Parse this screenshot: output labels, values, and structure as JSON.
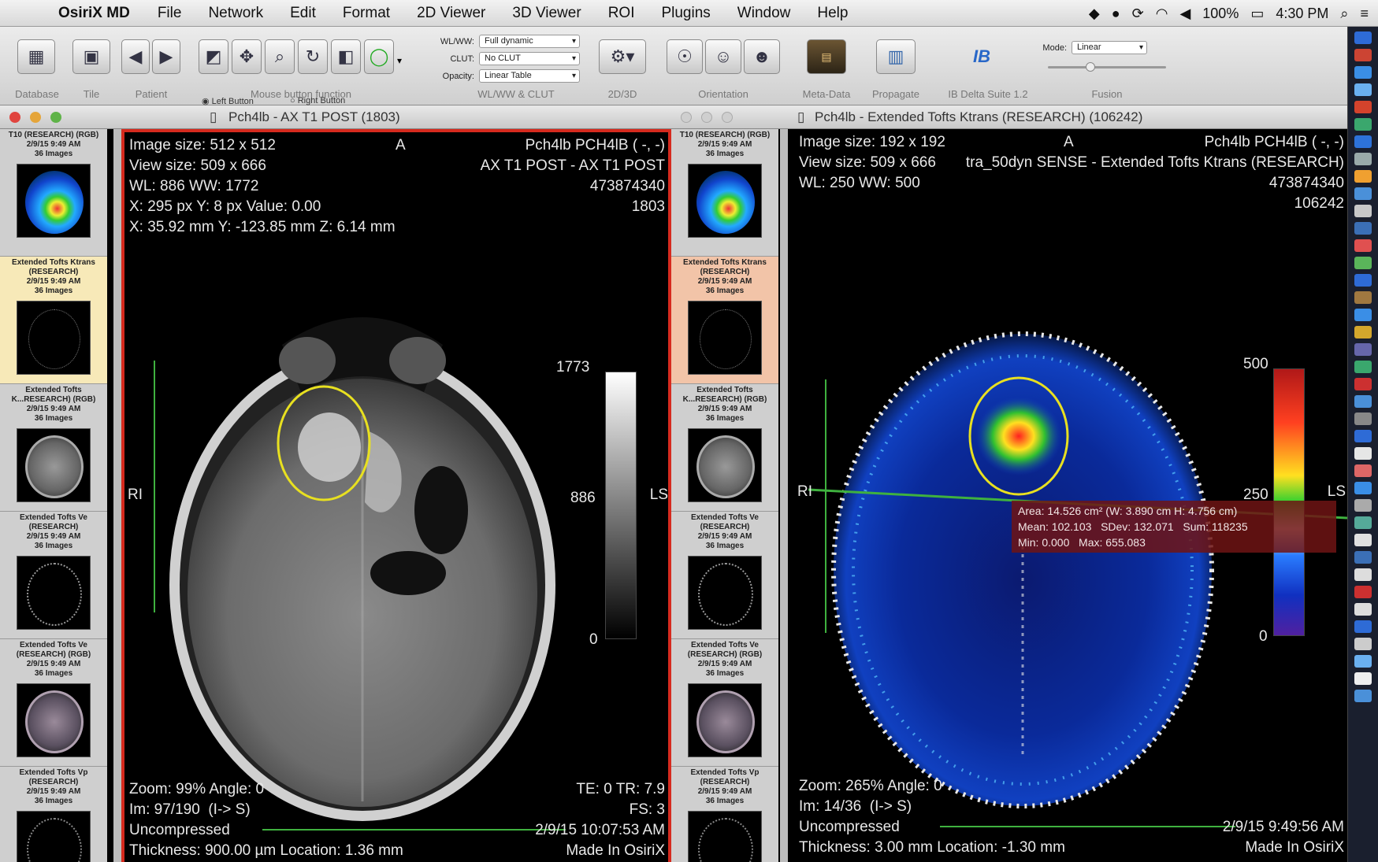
{
  "menubar": {
    "app": "OsiriX MD",
    "items": [
      "File",
      "Network",
      "Edit",
      "Format",
      "2D Viewer",
      "3D Viewer",
      "ROI",
      "Plugins",
      "Window",
      "Help"
    ],
    "battery": "100%",
    "time": "4:30 PM"
  },
  "toolbar": {
    "labels": {
      "database": "Database",
      "tile": "Tile",
      "patient": "Patient",
      "mouse": "Mouse button function",
      "wlww": "WL/WW & CLUT",
      "twoD3D": "2D/3D",
      "orientation": "Orientation",
      "metadata": "Meta-Data",
      "propagate": "Propagate",
      "delta": "IB Delta Suite 1.2",
      "fusion": "Fusion"
    },
    "left_button": "Left Button",
    "right_button": "Right Button",
    "wl_ww_label": "WL/WW:",
    "wl_ww_value": "Full dynamic",
    "clut_label": "CLUT:",
    "clut_value": "No CLUT",
    "opacity_label": "Opacity:",
    "opacity_value": "Linear Table",
    "mode_label": "Mode:",
    "mode_value": "Linear"
  },
  "left_window": {
    "title": "Pch4lb - AX T1 POST (1803)",
    "tl": [
      "Image size: 512 x 512",
      "View size: 509 x 666",
      "WL: 886 WW: 1772",
      "X: 295 px Y: 8 px Value: 0.00",
      "X: 35.92 mm Y: -123.85 mm Z: 6.14 mm"
    ],
    "top_marker": "A",
    "tr": [
      "Pch4lb PCH4lB ( -, -)",
      "AX T1 POST - AX T1 POST",
      "473874340",
      "1803"
    ],
    "left_marker": "RI",
    "right_marker": "LS",
    "scale_top": "1773",
    "scale_mid": "886",
    "scale_bottom": "0",
    "bl": [
      "Zoom: 99% Angle: 0",
      "Im: 97/190  (I-> S)",
      "Uncompressed",
      "Thickness: 900.00 µm Location: 1.36 mm"
    ],
    "br": [
      "TE: 0 TR: 7.9",
      "FS: 3",
      "2/9/15 10:07:53 AM",
      "Made In OsiriX"
    ]
  },
  "right_window": {
    "title": "Pch4lb - Extended Tofts Ktrans (RESEARCH) (106242)",
    "tl": [
      "Image size: 192 x 192",
      "View size: 509 x 666",
      "WL: 250 WW: 500"
    ],
    "top_marker": "A",
    "tr": [
      "Pch4lb PCH4lB ( -, -)",
      "tra_50dyn SENSE - Extended Tofts Ktrans (RESEARCH)",
      "473874340",
      "106242"
    ],
    "left_marker": "RI",
    "right_marker": "LS",
    "scale_top": "500",
    "scale_mid": "250",
    "scale_bottom": "0",
    "roi": [
      "Area: 14.526 cm² (W: 3.890 cm H: 4.756 cm)",
      "Mean: 102.103   SDev: 132.071   Sum: 118235",
      "Min: 0.000   Max: 655.083"
    ],
    "bl": [
      "Zoom: 265% Angle: 0",
      "Im: 14/36  (I-> S)",
      "Uncompressed",
      "Thickness: 3.00 mm Location: -1.30 mm"
    ],
    "br": [
      "2/9/15 9:49:56 AM",
      "Made In OsiriX"
    ]
  },
  "series": [
    {
      "label": "T10 (RESEARCH) (RGB)",
      "date": "2/9/15 9:49 AM",
      "count": "36 Images",
      "kind": "color"
    },
    {
      "label": "Extended Tofts Ktrans (RESEARCH)",
      "date": "2/9/15 9:49 AM",
      "count": "36 Images",
      "kind": "dark"
    },
    {
      "label": "Extended Tofts K...RESEARCH) (RGB)",
      "date": "2/9/15 9:49 AM",
      "count": "36 Images",
      "kind": "gray"
    },
    {
      "label": "Extended Tofts Ve (RESEARCH)",
      "date": "2/9/15 9:49 AM",
      "count": "36 Images",
      "kind": "dark"
    },
    {
      "label": "Extended Tofts Ve (RESEARCH) (RGB)",
      "date": "2/9/15 9:49 AM",
      "count": "36 Images",
      "kind": "gray"
    },
    {
      "label": "Extended Tofts Vp (RESEARCH)",
      "date": "2/9/15 9:49 AM",
      "count": "36 Images",
      "kind": "dark"
    }
  ],
  "colors": {
    "selected_left": "#f7e9b8",
    "selected_right": "#f2c4a8",
    "viewer_border": "#d62a1e",
    "roi": "#e8e020",
    "measure": "#3fb13f"
  }
}
